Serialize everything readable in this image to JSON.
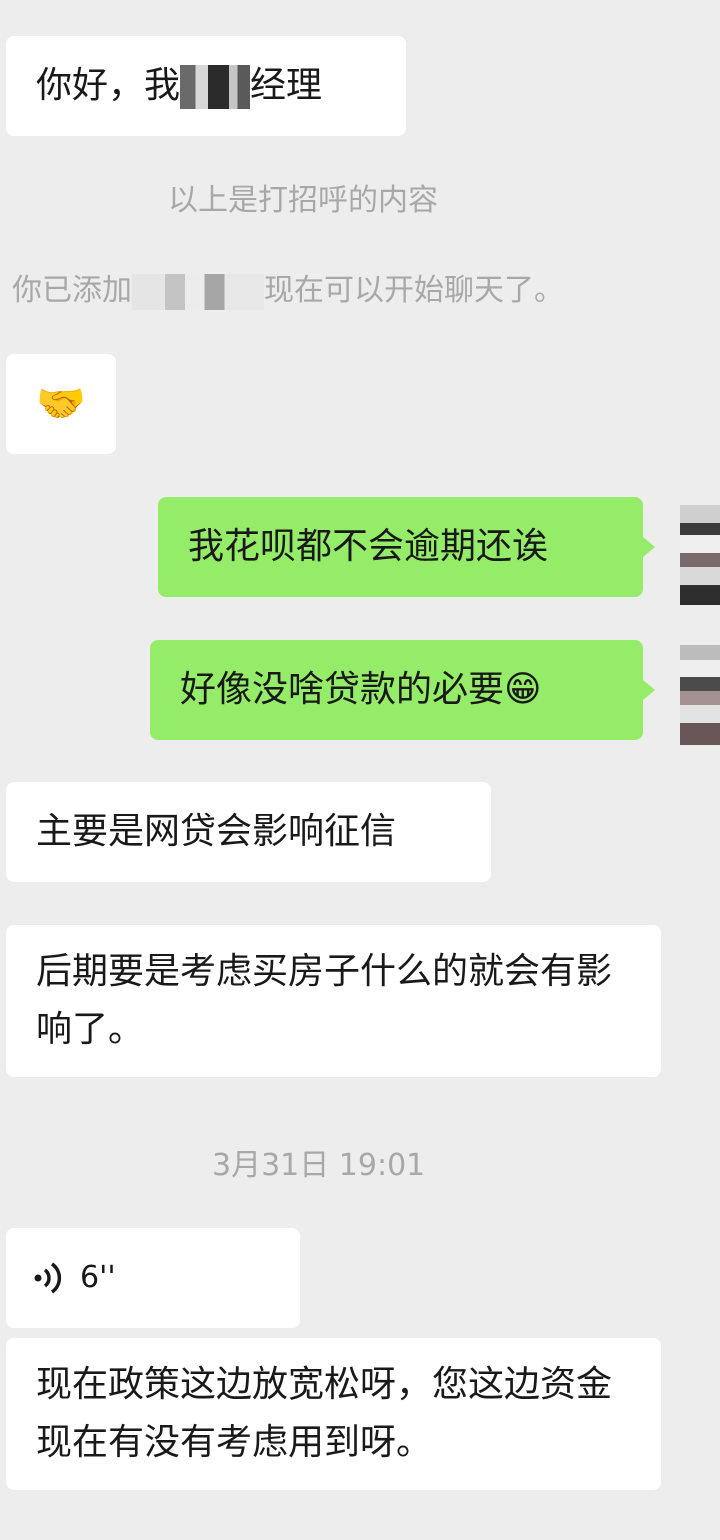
{
  "messages": {
    "m1": {
      "before": "你好，我",
      "after": "经理"
    },
    "greeting_notice": "以上是打招呼的内容",
    "added_notice": {
      "before": "你已添加",
      "after": "现在可以开始聊天了。"
    },
    "m2_emoji": "🤝",
    "m3": "我花呗都不会逾期还诶",
    "m4": "好像没啥贷款的必要",
    "m4_emoji": "😁",
    "m5": "主要是网贷会影响征信",
    "m6": "后期要是考虑买房子什么的就会有影响了。",
    "timestamp": "3月31日 19:01",
    "voice": {
      "duration": "6''"
    },
    "m7": "现在政策这边放宽松呀，您这边资金现在有没有考虑用到呀。"
  },
  "colors": {
    "background": "#ededed",
    "incoming_bubble": "#ffffff",
    "outgoing_bubble": "#95ec69",
    "system_text": "#a8a8a8"
  }
}
